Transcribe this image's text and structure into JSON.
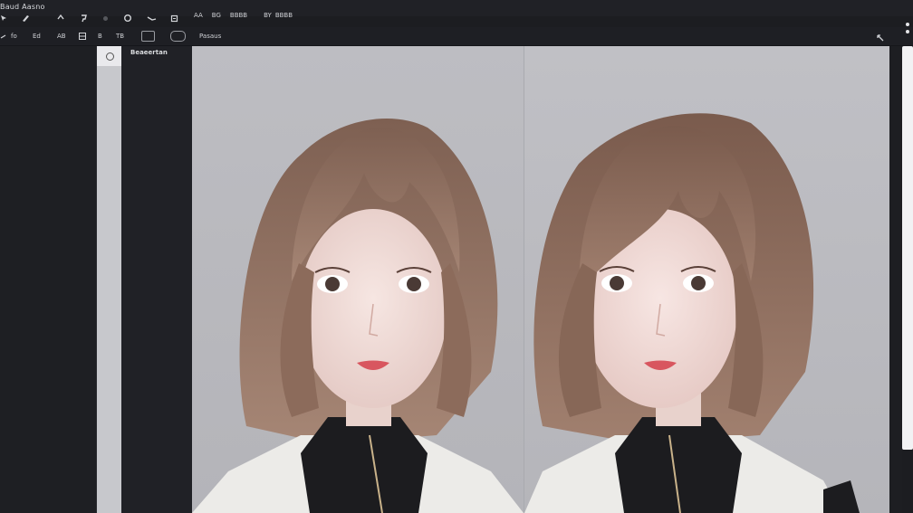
{
  "app": {
    "title": "Baud Aasno"
  },
  "menu": {
    "icons": [
      "pointer-icon",
      "brush-icon",
      "lasso-icon",
      "text-tool-icon",
      "paint-bucket-icon",
      "rotate-icon",
      "pen-icon",
      "crop-icon"
    ],
    "labels": [
      "AA",
      "BG",
      "BBBB",
      "BY",
      "BBBB"
    ]
  },
  "toolbar": {
    "items": [
      "fo",
      "Ed",
      "AB",
      "B",
      "B",
      "B",
      "TB"
    ],
    "extra_label": "Pasaus"
  },
  "layers_panel": {
    "title": "Beaeertan"
  },
  "canvas": {
    "images": [
      {
        "label": "portrait-left"
      },
      {
        "label": "portrait-right"
      }
    ]
  }
}
